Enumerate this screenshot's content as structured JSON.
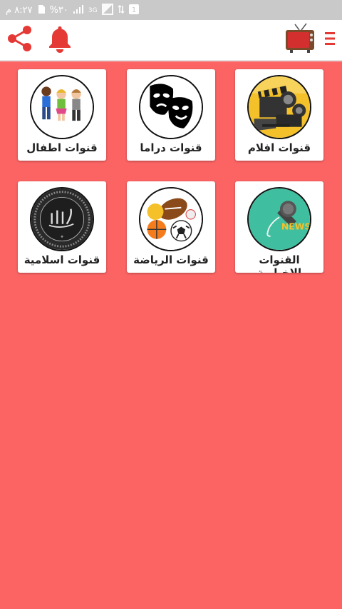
{
  "status_bar": {
    "time": "٨:٢٧ م",
    "battery": "%٣٠",
    "network": "3G"
  },
  "app_bar": {
    "share_icon": "share-icon",
    "notification_icon": "bell-icon",
    "logo_icon": "tv-icon",
    "menu_icon": "menu-icon",
    "accent_color": "#e53935"
  },
  "categories": [
    {
      "label": "قنوات افلام",
      "icon": "film-projector-icon"
    },
    {
      "label": "قنوات دراما",
      "icon": "drama-masks-icon"
    },
    {
      "label": "قنوات اطفال",
      "icon": "kids-icon"
    },
    {
      "label": "القنوات الاخبارية",
      "icon": "news-microphone-icon"
    },
    {
      "label": "قنوات الرياضة",
      "icon": "sports-balls-icon"
    },
    {
      "label": "قنوات اسلامية",
      "icon": "islamic-calligraphy-icon"
    }
  ],
  "colors": {
    "background": "#fc6464",
    "card": "#ffffff",
    "status_bar": "#c9c9c9"
  }
}
